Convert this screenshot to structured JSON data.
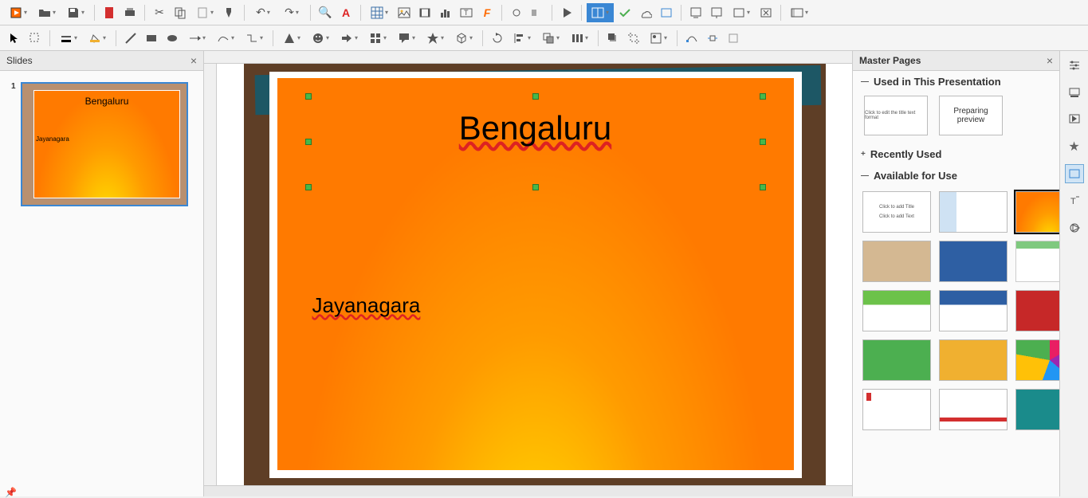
{
  "toolbar1": {
    "icons": [
      "new",
      "open",
      "save",
      "pdf",
      "print",
      "cut",
      "copy",
      "paste",
      "clone",
      "brush",
      "undo",
      "redo",
      "find",
      "spell",
      "table",
      "image",
      "av",
      "chart",
      "textbox",
      "fontwork",
      "hyperlink",
      "insert",
      "start",
      "window",
      "check",
      "cloud",
      "master",
      "slide",
      "prop",
      "layout",
      "close",
      "views"
    ]
  },
  "slides_panel": {
    "title": "Slides",
    "slides": [
      {
        "num": "1",
        "title": "Bengaluru",
        "body": "Jayanagara"
      }
    ]
  },
  "canvas": {
    "title": "Bengaluru",
    "body": "Jayanagara"
  },
  "master_panel": {
    "title": "Master Pages",
    "sections": {
      "used": "Used in This Presentation",
      "recent": "Recently Used",
      "available": "Available for Use"
    },
    "preparing": "Preparing preview",
    "used_thumbs": [
      {
        "label": "Click to edit the title text format"
      }
    ]
  }
}
